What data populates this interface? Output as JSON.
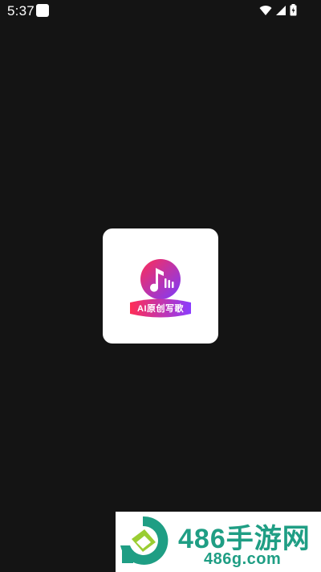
{
  "status_bar": {
    "time": "5:37",
    "icons": [
      "app-notification-icon",
      "wifi-icon",
      "signal-icon",
      "battery-charging-icon"
    ]
  },
  "splash": {
    "app_label": "AI原创写歌",
    "icon": "music-note-icon"
  },
  "watermark": {
    "title": "486手游网",
    "url": "486g.com",
    "logo": "486-logo-icon"
  },
  "colors": {
    "background": "#141414",
    "card": "#ffffff",
    "icon_gradient_start": "#ff2d55",
    "icon_gradient_end": "#7b3bff",
    "watermark_green": "#1f9e84"
  }
}
